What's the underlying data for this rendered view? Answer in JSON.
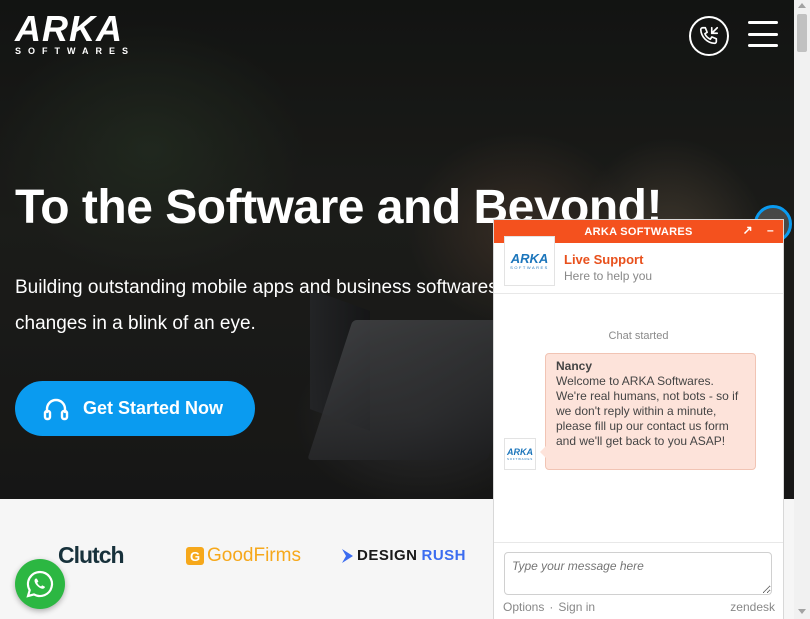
{
  "header": {
    "logo_text": "ARKA",
    "logo_subtext": "SOFTWARES",
    "phone_icon": "phone-icon",
    "menu_icon": "hamburger-icon"
  },
  "hero": {
    "title": "To the Software and Beyond!",
    "subtitle": "Building outstanding mobile apps and business softwares changes in a blink of an eye.",
    "cta_label": "Get Started Now",
    "cta_color": "#0a9bf0"
  },
  "logos": {
    "clutch": "Clutch",
    "goodfirms": "GoodFirms",
    "designrush_design": "DESIGN",
    "designrush_rush": "RUSH"
  },
  "chat": {
    "header_title": "ARKA SOFTWARES",
    "header_color": "#f4511e",
    "agent_logo": "ARKA",
    "agent_logo_sub": "SOFTWARES",
    "agent_name": "Live Support",
    "agent_tagline": "Here to help you",
    "status": "Chat started",
    "message": {
      "sender": "Nancy",
      "text": "Welcome to ARKA Softwares. We're real humans, not bots - so if we don't reply within a minute, please fill up our contact us form and we'll get back to you ASAP!"
    },
    "input_placeholder": "Type your message here",
    "footer_options": "Options",
    "footer_signin": "Sign in",
    "footer_brand": "zendesk"
  }
}
